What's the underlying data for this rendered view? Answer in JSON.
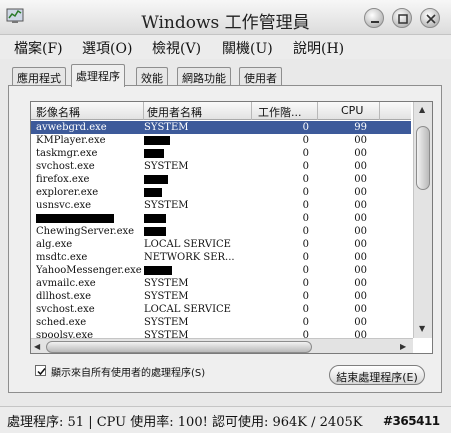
{
  "window": {
    "title": "Windows 工作管理員",
    "icon": "task-manager-icon"
  },
  "window_controls": [
    "minimize-icon",
    "maximize-icon",
    "close-icon"
  ],
  "menu": [
    {
      "label": "檔案(F)"
    },
    {
      "label": "選項(O)"
    },
    {
      "label": "檢視(V)"
    },
    {
      "label": "關機(U)"
    },
    {
      "label": "說明(H)"
    }
  ],
  "tabs": [
    {
      "label": "應用程式",
      "active": false
    },
    {
      "label": "處理程序",
      "active": true
    },
    {
      "label": "效能",
      "active": false
    },
    {
      "label": "網路功能",
      "active": false
    },
    {
      "label": "使用者",
      "active": false
    }
  ],
  "table": {
    "columns": [
      "影像名稱",
      "使用者名稱",
      "工作階...",
      "CPU"
    ],
    "rows": [
      {
        "name": "avwebgrd.exe",
        "user": "SYSTEM",
        "session": "0",
        "cpu": "99",
        "selected": true
      },
      {
        "name": "KMPlayer.exe",
        "user": "",
        "user_redacted": true,
        "session": "0",
        "cpu": "00"
      },
      {
        "name": "taskmgr.exe",
        "user": "",
        "user_redacted": true,
        "session": "0",
        "cpu": "00"
      },
      {
        "name": "svchost.exe",
        "user": "SYSTEM",
        "session": "0",
        "cpu": "00"
      },
      {
        "name": "firefox.exe",
        "user": "",
        "user_redacted": true,
        "session": "0",
        "cpu": "00"
      },
      {
        "name": "explorer.exe",
        "user": "",
        "user_redacted": true,
        "session": "0",
        "cpu": "00"
      },
      {
        "name": "usnsvc.exe",
        "user": "SYSTEM",
        "session": "0",
        "cpu": "00"
      },
      {
        "name": "",
        "name_redacted": true,
        "user": "",
        "user_redacted": true,
        "session": "0",
        "cpu": "00"
      },
      {
        "name": "ChewingServer.exe",
        "user": "",
        "user_redacted": true,
        "session": "0",
        "cpu": "00"
      },
      {
        "name": "alg.exe",
        "user": "LOCAL SERVICE",
        "session": "0",
        "cpu": "00"
      },
      {
        "name": "msdtc.exe",
        "user": "NETWORK SER...",
        "session": "0",
        "cpu": "00"
      },
      {
        "name": "YahooMessenger.exe",
        "user": "",
        "user_redacted": true,
        "session": "0",
        "cpu": "00"
      },
      {
        "name": "avmailc.exe",
        "user": "SYSTEM",
        "session": "0",
        "cpu": "00"
      },
      {
        "name": "dllhost.exe",
        "user": "SYSTEM",
        "session": "0",
        "cpu": "00"
      },
      {
        "name": "svchost.exe",
        "user": "LOCAL SERVICE",
        "session": "0",
        "cpu": "00"
      },
      {
        "name": "sched.exe",
        "user": "SYSTEM",
        "session": "0",
        "cpu": "00"
      },
      {
        "name": "spoolsv.exe",
        "user": "SYSTEM",
        "session": "0",
        "cpu": "00"
      }
    ]
  },
  "show_all_users": {
    "label": "顯示來自所有使用者的處理程序(S)",
    "checked": true
  },
  "end_process_button": "結束處理程序(E)",
  "status": {
    "processes": "處理程序: 51",
    "cpu_usage": "CPU 使用率: 100!",
    "commit": "認可使用: 964K / 2405K"
  },
  "watermark": "#365411",
  "colors": {
    "selection": "#3d5a9a",
    "window_bg": "#e9e9e9"
  }
}
